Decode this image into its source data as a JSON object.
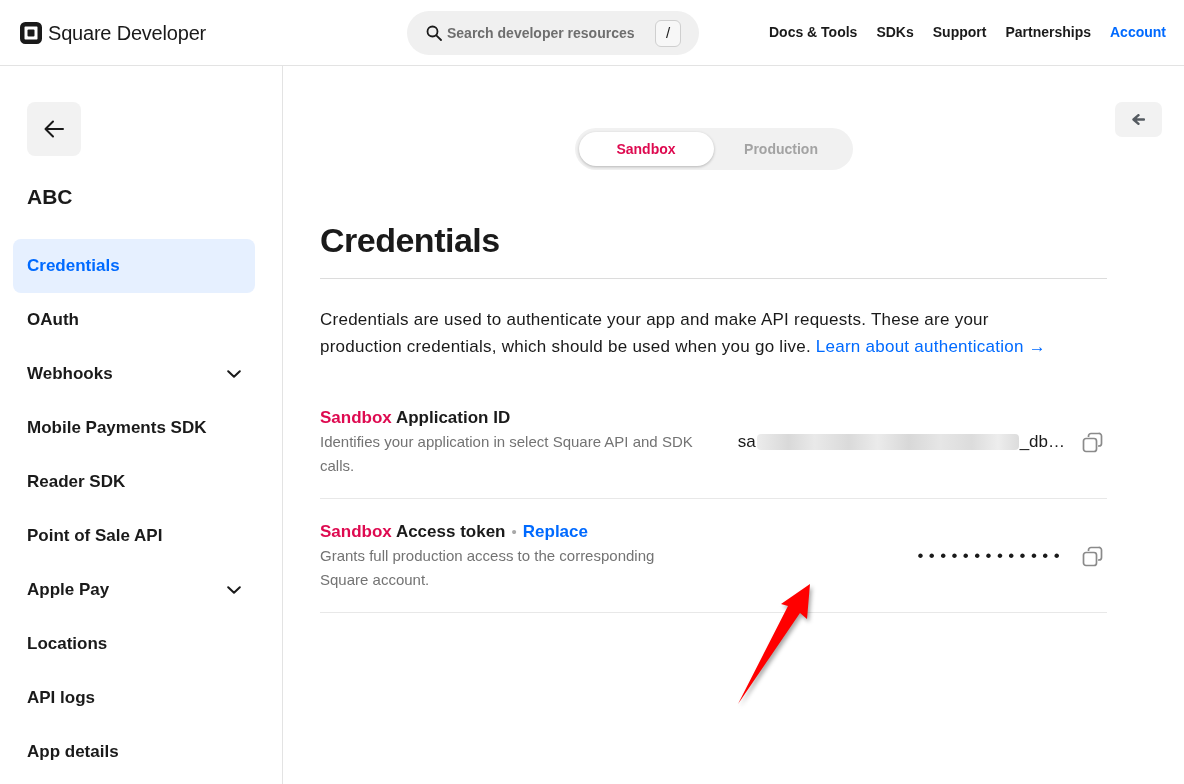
{
  "header": {
    "brand": "Square Developer",
    "search": {
      "placeholder": "Search developer resources",
      "shortcut": "/"
    },
    "nav": [
      {
        "label": "Docs & Tools",
        "selected": false
      },
      {
        "label": "SDKs",
        "selected": false
      },
      {
        "label": "Support",
        "selected": false
      },
      {
        "label": "Partnerships",
        "selected": false
      },
      {
        "label": "Account",
        "selected": true
      }
    ]
  },
  "sidebar": {
    "app_name": "ABC",
    "items": [
      {
        "label": "Credentials",
        "kind": "link",
        "selected": true
      },
      {
        "label": "OAuth",
        "kind": "link",
        "selected": false
      },
      {
        "label": "Webhooks",
        "kind": "group",
        "selected": false
      },
      {
        "label": "Mobile Payments SDK",
        "kind": "link",
        "selected": false
      },
      {
        "label": "Reader SDK",
        "kind": "link",
        "selected": false
      },
      {
        "label": "Point of Sale API",
        "kind": "link",
        "selected": false
      },
      {
        "label": "Apple Pay",
        "kind": "group",
        "selected": false
      },
      {
        "label": "Locations",
        "kind": "link",
        "selected": false
      },
      {
        "label": "API logs",
        "kind": "link",
        "selected": false
      },
      {
        "label": "App details",
        "kind": "link",
        "selected": false
      }
    ]
  },
  "environment_toggle": [
    {
      "label": "Sandbox",
      "selected": true
    },
    {
      "label": "Production",
      "selected": false
    }
  ],
  "page": {
    "title": "Credentials",
    "intro": "Credentials are used to authenticate your app and make API requests. These are your production credentials, which should be used when you go live.",
    "intro_link": "Learn about authentication →"
  },
  "credentials": [
    {
      "kind": "id",
      "environment": "Sandbox",
      "label": "Application ID",
      "description": "Identifies your application in select Square API and SDK calls.",
      "value_start": "sa",
      "redacted": true,
      "value_end": "_db…"
    },
    {
      "kind": "secret",
      "environment": "Sandbox",
      "label": "Access token",
      "separator": "•",
      "action": "Replace",
      "description": "Grants full production access to the corresponding Square account.",
      "masked_value": "•••••••••••••"
    }
  ],
  "annotations": [
    {
      "kind": "arrow"
    }
  ]
}
